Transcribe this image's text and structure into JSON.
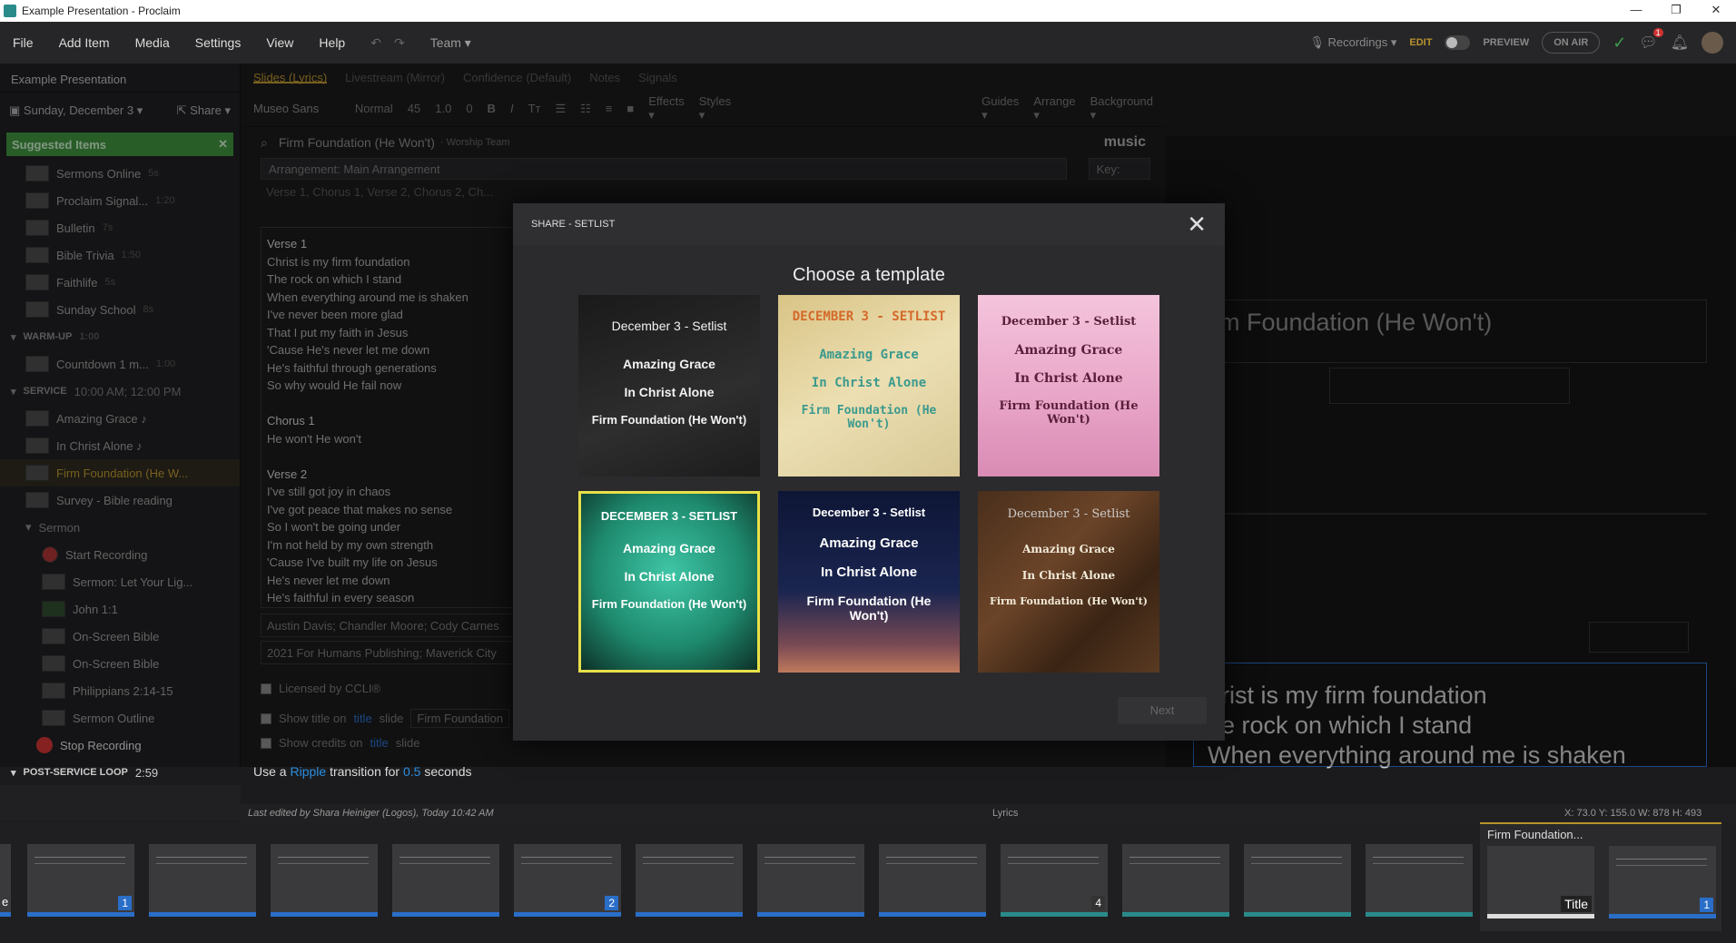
{
  "window": {
    "title": "Example Presentation - Proclaim",
    "min": "—",
    "max": "❐",
    "close": "✕"
  },
  "menu": [
    "File",
    "Add Item",
    "Media",
    "Settings",
    "View",
    "Help"
  ],
  "team": "Team ▾",
  "topbar": {
    "recordings": "Recordings ▾",
    "edit": "EDIT",
    "preview": "PREVIEW",
    "onair": "ON AIR",
    "badge": "1"
  },
  "left": {
    "presentation_title": "Example Presentation",
    "date": "Sunday, December 3 ▾",
    "share": "Share ▾",
    "suggested": "Suggested Items",
    "suggested_items": [
      {
        "label": "Sermons Online",
        "meta": "5s"
      },
      {
        "label": "Proclaim Signal...",
        "meta": "1:20"
      },
      {
        "label": "Bulletin",
        "meta": "7s"
      },
      {
        "label": "Bible Trivia",
        "meta": "1:50"
      },
      {
        "label": "Faithlife",
        "meta": "5s"
      },
      {
        "label": "Sunday School",
        "meta": "8s"
      }
    ],
    "warmup": {
      "label": "WARM-UP",
      "meta": "1:00"
    },
    "warmup_items": [
      {
        "label": "Countdown 1 m...",
        "meta": "1:00"
      }
    ],
    "service": {
      "label": "SERVICE",
      "meta": "10:00 AM; 12:00 PM"
    },
    "service_items": [
      {
        "label": "Amazing Grace ♪"
      },
      {
        "label": "In Christ Alone ♪"
      },
      {
        "label": "Firm Foundation (He W..."
      },
      {
        "label": "Survey - Bible reading"
      }
    ],
    "sermon": "Sermon",
    "sermon_items": [
      "Start Recording",
      "Sermon: Let Your Lig...",
      "John 1:1",
      "On-Screen Bible",
      "On-Screen Bible",
      "Philippians 2:14-15",
      "Sermon Outline"
    ],
    "stop_recording": "Stop Recording",
    "postservice": {
      "label": "POST-SERVICE LOOP",
      "meta": "2:59"
    }
  },
  "middle": {
    "tabs": [
      "Slides (Lyrics)",
      "Livestream (Mirror)",
      "Confidence (Default)",
      "Notes",
      "Signals"
    ],
    "font": "Museo Sans",
    "style": "Normal",
    "size": "45",
    "line": "1.0",
    "spacing": "0",
    "effects": "Effects ▾",
    "styles": "Styles ▾",
    "song": "Firm Foundation (He Won't)",
    "team": "· Worship Team",
    "music": "music",
    "arrangement": "Arrangement: Main Arrangement",
    "key": "Key:",
    "order": "Verse 1, Chorus 1, Verse 2, Chorus 2, Ch...",
    "lyrics": [
      "Verse 1",
      "Christ is my firm foundation",
      "The rock on which I stand",
      "When everything around me is shaken",
      "I've never been more glad",
      "That I put my faith in Jesus",
      "'Cause He's never let me down",
      "He's faithful through generations",
      "So why would He fail now",
      "",
      "Chorus 1",
      "He won't He won't",
      "",
      "Verse 2",
      "I've still got joy in chaos",
      "I've got peace that makes no sense",
      "So I won't be going under",
      "I'm not held by my own strength",
      "'Cause I've built my life on Jesus",
      "He's never let me down",
      "He's faithful in every season",
      "So why would He fail now"
    ],
    "authors": "Austin Davis; Chandler Moore; Cody Carnes",
    "copyright": "2021 For Humans Publishing; Maverick City",
    "ccli": "Licensed by CCLI®",
    "show_title_pre": "Show title on",
    "show_title_link": "title",
    "show_title_post": "slide",
    "show_title_value": "Firm Foundation",
    "show_credits_pre": "Show credits on",
    "show_credits_link": "title",
    "show_credits_post": "slide",
    "transition_pre": "Use a",
    "transition_link": "Ripple",
    "transition_mid": "transition for",
    "transition_secs": "0.5",
    "transition_post": "seconds"
  },
  "right": {
    "guides": "Guides ▾",
    "arrange": "Arrange ▾",
    "background": "Background ▾",
    "title": "rm Foundation (He Won't)",
    "lyrics": [
      "hrist is my firm foundation",
      "he rock on which I stand",
      "When everything around me is shaken"
    ]
  },
  "status": {
    "edited": "Last edited by Shara Heiniger (Logos), Today 10:42 AM",
    "mode": "Lyrics",
    "coords": "X: 73.0  Y: 155.0  W: 878  H: 493"
  },
  "filmstrip": {
    "numbers": [
      "1",
      "2",
      "4",
      "1"
    ],
    "title_card": "Firm Foundation...",
    "title_label": "Title",
    "left_label": "e"
  },
  "modal": {
    "header": "SHARE - SETLIST",
    "heading": "Choose a template",
    "next": "Next",
    "templates": [
      {
        "line1": "December 3 - Setlist",
        "songs": [
          "Amazing Grace",
          "In Christ Alone",
          "Firm Foundation (He Won't)"
        ]
      },
      {
        "line1": "DECEMBER 3 - SETLIST",
        "songs": [
          "Amazing Grace",
          "In Christ Alone",
          "Firm Foundation (He Won't)"
        ]
      },
      {
        "line1": "December 3 - Setlist",
        "songs": [
          "Amazing Grace",
          "In Christ Alone",
          "Firm Foundation (He Won't)"
        ]
      },
      {
        "line1": "DECEMBER 3 - SETLIST",
        "songs": [
          "Amazing Grace",
          "In Christ Alone",
          "Firm Foundation (He Won't)"
        ]
      },
      {
        "line1": "December 3 - Setlist",
        "songs": [
          "Amazing Grace",
          "In Christ Alone",
          "Firm Foundation (He Won't)"
        ]
      },
      {
        "line1": "December 3 - Setlist",
        "songs": [
          "Amazing Grace",
          "In Christ Alone",
          "Firm Foundation (He Won't)"
        ]
      }
    ]
  }
}
